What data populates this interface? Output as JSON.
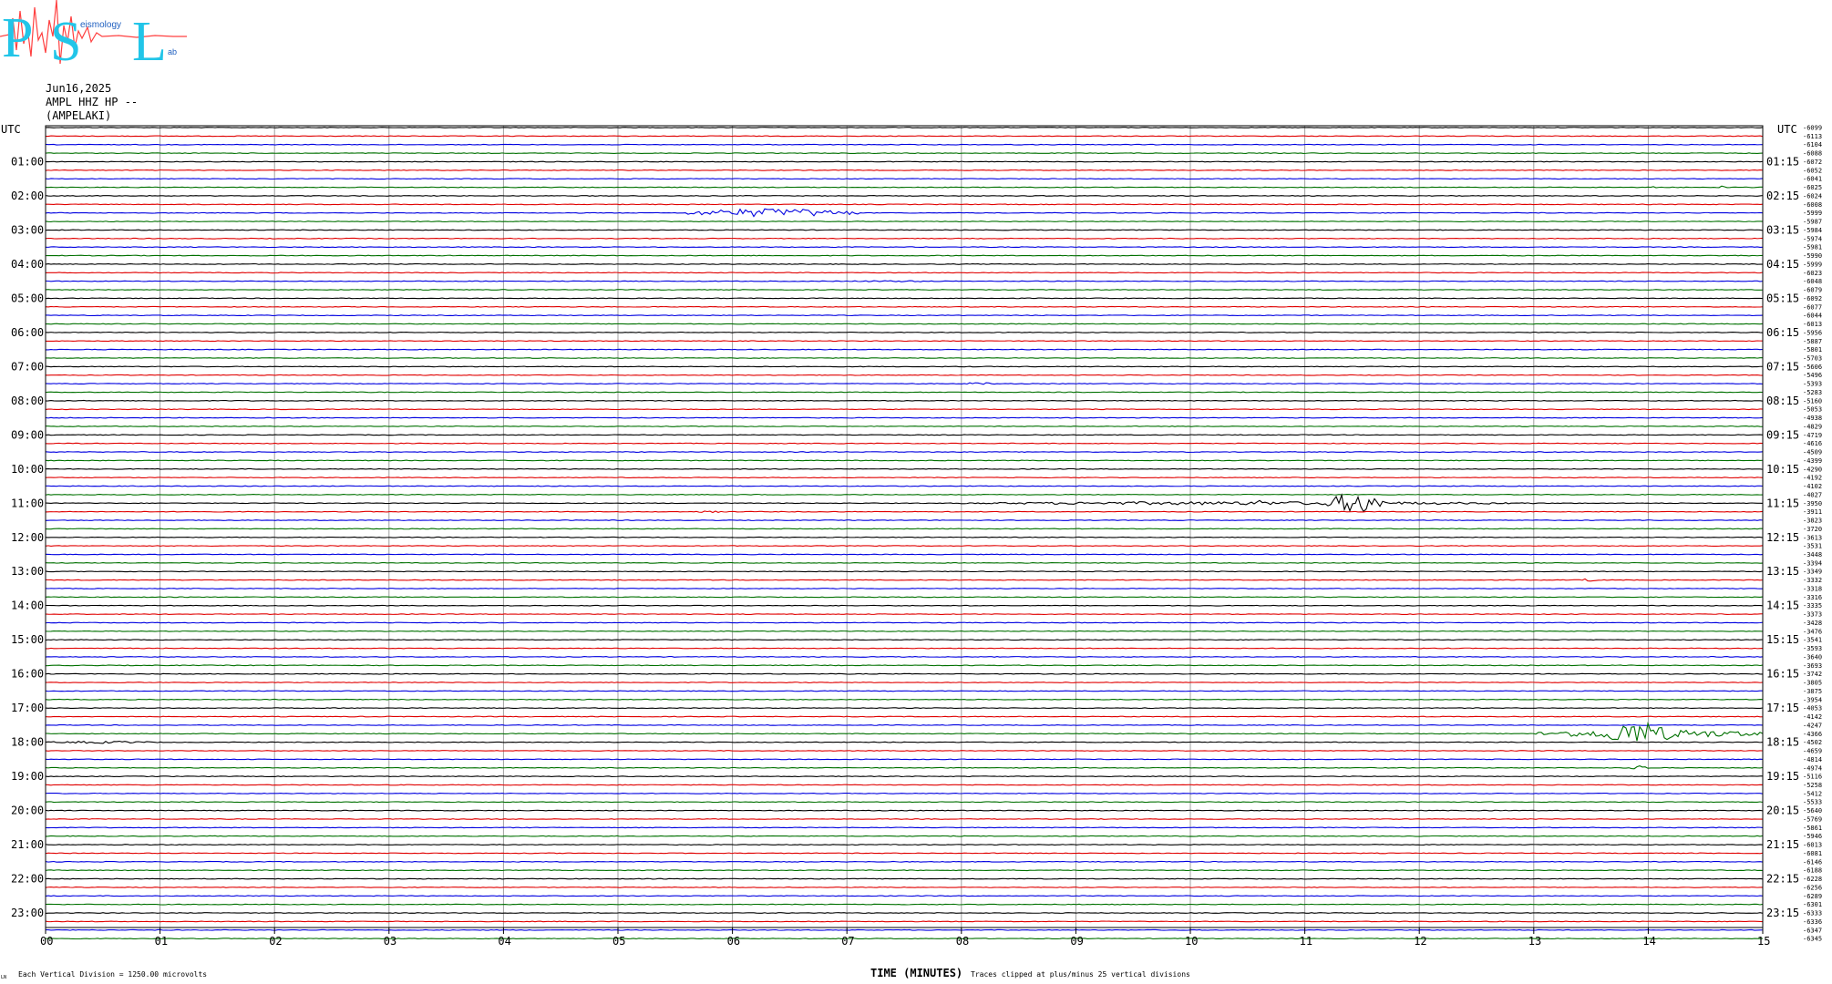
{
  "logo": {
    "letters": [
      "P",
      "S",
      "L"
    ],
    "small_words": [
      "eismology",
      "ab"
    ]
  },
  "header": {
    "date": "Jun16,2025",
    "channel": "AMPL HHZ HP --",
    "station": "(AMPELAKI)"
  },
  "chart_data": {
    "type": "line",
    "title": "",
    "xlabel": "TIME (MINUTES)",
    "xlim": [
      0,
      15
    ],
    "x_ticks": [
      "00",
      "01",
      "02",
      "03",
      "04",
      "05",
      "06",
      "07",
      "08",
      "09",
      "10",
      "11",
      "12",
      "13",
      "14",
      "15"
    ],
    "ylabel_left": "UTC",
    "ylabel_right": "UTC",
    "row_minutes": 15,
    "rows": 96,
    "left_hour_labels": [
      "01:00",
      "02:00",
      "03:00",
      "04:00",
      "05:00",
      "06:00",
      "07:00",
      "08:00",
      "09:00",
      "10:00",
      "11:00",
      "12:00",
      "13:00",
      "14:00",
      "15:00",
      "16:00",
      "17:00",
      "18:00",
      "19:00",
      "20:00",
      "21:00",
      "22:00",
      "23:00"
    ],
    "right_hour_labels": [
      "01:15",
      "02:15",
      "03:15",
      "04:15",
      "05:15",
      "06:15",
      "07:15",
      "08:15",
      "09:15",
      "10:15",
      "11:15",
      "12:15",
      "13:15",
      "14:15",
      "15:15",
      "16:15",
      "17:15",
      "18:15",
      "19:15",
      "20:15",
      "21:15",
      "22:15",
      "23:15"
    ],
    "trace_colors": [
      "#000000",
      "#e00000",
      "#0000e0",
      "#007000"
    ],
    "offsets": [
      -6099,
      -6113,
      -6104,
      -6088,
      -6072,
      -6052,
      -6041,
      -6025,
      -6024,
      -6008,
      -5999,
      -5987,
      -5984,
      -5974,
      -5981,
      -5990,
      -5999,
      -6023,
      -6048,
      -6079,
      -6092,
      -6077,
      -6044,
      -6013,
      -5956,
      -5887,
      -5801,
      -5703,
      -5606,
      -5496,
      -5393,
      -5283,
      -5160,
      -5053,
      -4938,
      -4829,
      -4719,
      -4616,
      -4509,
      -4399,
      -4290,
      -4192,
      -4102,
      -4027,
      -3950,
      -3911,
      -3823,
      -3720,
      -3613,
      -3531,
      -3448,
      -3394,
      -3349,
      -3332,
      -3318,
      -3316,
      -3335,
      -3373,
      -3428,
      -3476,
      -3541,
      -3593,
      -3640,
      -3693,
      -3742,
      -3805,
      -3875,
      -3954,
      -4053,
      -4142,
      -4247,
      -4366,
      -4502,
      -4659,
      -4814,
      -4974,
      -5116,
      -5258,
      -5412,
      -5533,
      -5640,
      -5769,
      -5861,
      -5946,
      -6013,
      -6081,
      -6146,
      -6188,
      -6228,
      -6256,
      -6289,
      -6301,
      -6333,
      -6336,
      -6347,
      -6345
    ],
    "events": [
      {
        "row": 10,
        "start_min": 5.6,
        "end_min": 7.1,
        "amp_divisions": 0.9
      },
      {
        "row": 7,
        "start_min": 14.0,
        "end_min": 14.1,
        "amp_divisions": 0.5
      },
      {
        "row": 7,
        "start_min": 14.6,
        "end_min": 14.7,
        "amp_divisions": 0.4
      },
      {
        "row": 44,
        "start_min": 8.0,
        "end_min": 13.0,
        "amp_divisions": 0.35
      },
      {
        "row": 44,
        "start_min": 11.2,
        "end_min": 11.7,
        "amp_divisions": 2.2
      },
      {
        "row": 44,
        "start_min": 10.6,
        "end_min": 10.65,
        "amp_divisions": 1.5
      },
      {
        "row": 45,
        "start_min": 5.7,
        "end_min": 5.9,
        "amp_divisions": 0.35
      },
      {
        "row": 53,
        "start_min": 13.4,
        "end_min": 13.55,
        "amp_divisions": 0.35
      },
      {
        "row": 71,
        "start_min": 13.0,
        "end_min": 15.0,
        "amp_divisions": 0.9
      },
      {
        "row": 71,
        "start_min": 13.6,
        "end_min": 14.2,
        "amp_divisions": 2.6
      },
      {
        "row": 72,
        "start_min": 0.0,
        "end_min": 1.0,
        "amp_divisions": 0.25
      },
      {
        "row": 75,
        "start_min": 13.85,
        "end_min": 14.0,
        "amp_divisions": 0.6
      },
      {
        "row": 30,
        "start_min": 8.0,
        "end_min": 8.3,
        "amp_divisions": 0.25
      },
      {
        "row": 18,
        "start_min": 6.9,
        "end_min": 7.9,
        "amp_divisions": 0.15
      }
    ]
  },
  "footer": {
    "left_note": "Each Vertical Division = 1250.00 microvolts",
    "center_note": "Traces clipped at plus/minus 25 vertical divisions",
    "corner_mark": "LN"
  }
}
